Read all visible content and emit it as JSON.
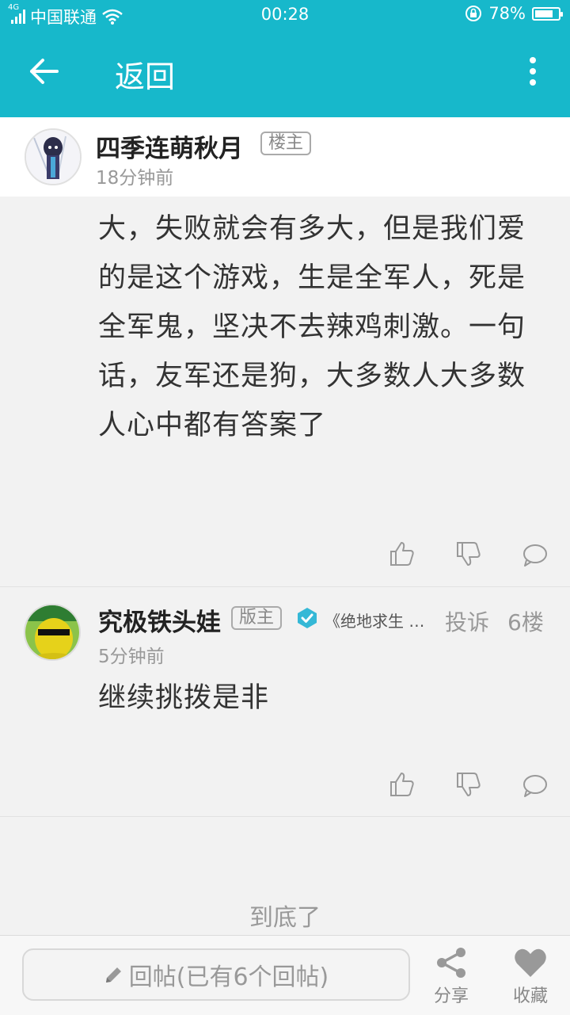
{
  "status_bar": {
    "net_type": "4G",
    "carrier": "中国联通",
    "time": "00:28",
    "battery": "78%",
    "battery_level": 0.78
  },
  "app_bar": {
    "title": "返回"
  },
  "op": {
    "username": "四季连萌秋月",
    "tag": "楼主",
    "time": "18分钟前",
    "body": "大，失败就会有多大，但是我们爱的是这个游戏，生是全军人，死是全军鬼，坚决不去辣鸡刺激。一句话，友军还是狗，大多数人大多数人心中都有答案了"
  },
  "reply": {
    "username": "究极铁头娃",
    "tag": "版主",
    "forum": "《绝地求生 全...",
    "report_label": "投诉",
    "floor": "6楼",
    "time": "5分钟前",
    "body": "继续挑拨是非"
  },
  "end_text": "到底了",
  "bottom_bar": {
    "reply_placeholder": "回帖(已有6个回帖)",
    "share_label": "分享",
    "favorite_label": "收藏"
  }
}
